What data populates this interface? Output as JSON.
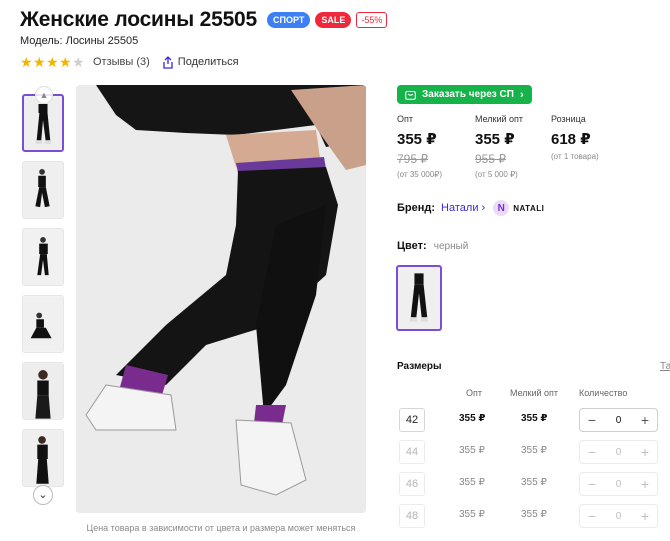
{
  "product": {
    "title": "Женские лосины 25505",
    "badges": {
      "sport": "СПОРТ",
      "sale": "SALE",
      "discount": "-55%"
    },
    "model": "Модель: Лосины 25505",
    "rating": {
      "value": 4,
      "max": 5
    },
    "reviews_label": "Отзывы (3)",
    "share_label": "Поделиться"
  },
  "gallery": {
    "note": "Цена товара в зависимости от цвета и размера может меняться",
    "thumbnail_count": 6,
    "active_thumbnail": 1
  },
  "order_button": {
    "label": "Заказать через СП",
    "arrow": "›"
  },
  "prices": [
    {
      "label": "Опт",
      "value": "355 ₽",
      "old": "795 ₽",
      "note": "(от 35 000₽)"
    },
    {
      "label": "Мелкий опт",
      "value": "355 ₽",
      "old": "955 ₽",
      "note": "(от 5 000 ₽)"
    },
    {
      "label": "Розница",
      "value": "618 ₽",
      "old": "",
      "note": "(от 1 товара)"
    }
  ],
  "brand": {
    "label": "Бренд:",
    "name": "Натали",
    "arrow": "›",
    "logo_letter": "N",
    "logo_text": "NATALI"
  },
  "color": {
    "label": "Цвет:",
    "value": "черный"
  },
  "sizes": {
    "title": "Размеры",
    "table_link": "Та",
    "headers": {
      "opt": "Опт",
      "small_opt": "Мелкий опт",
      "qty": "Количество"
    },
    "rows": [
      {
        "size": "42",
        "opt": "355 ₽",
        "small_opt": "355 ₽",
        "qty": "0",
        "minus": "−",
        "plus": "+",
        "available": true
      },
      {
        "size": "44",
        "opt": "355 ₽",
        "small_opt": "355 ₽",
        "qty": "0",
        "minus": "−",
        "plus": "+",
        "available": false
      },
      {
        "size": "46",
        "opt": "355 ₽",
        "small_opt": "355 ₽",
        "qty": "0",
        "minus": "−",
        "plus": "+",
        "available": false
      },
      {
        "size": "48",
        "opt": "355 ₽",
        "small_opt": "355 ₽",
        "qty": "0",
        "minus": "−",
        "plus": "+",
        "available": false
      }
    ]
  },
  "colors": {
    "accent": "#7a4dd8",
    "order_green": "#16b34a",
    "sale_red": "#f0283c",
    "sport_blue": "#3d7ff5",
    "star": "#f5b400"
  }
}
